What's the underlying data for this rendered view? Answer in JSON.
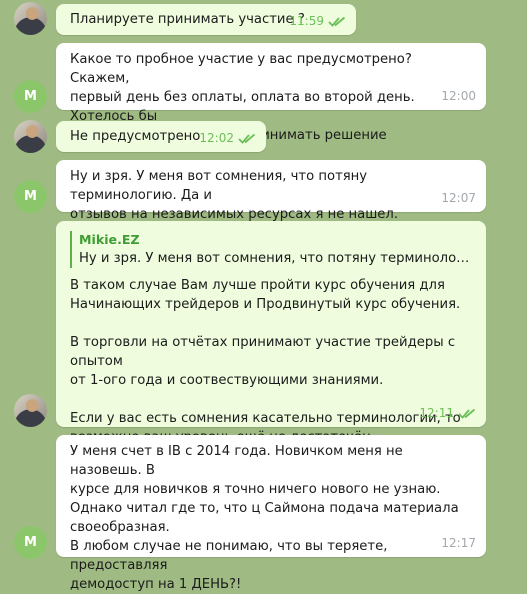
{
  "messages": [
    {
      "author": "self",
      "text": "Планируете принимать участие ?",
      "time": "11:59",
      "read": true
    },
    {
      "author": "other",
      "avatar_letter": "M",
      "text": "Какое то пробное участие у вас предусмотрено? Скажем,\nпервый день без оплаты, оплата во второй день. Хотелось бы\nпосмотреть прежде чем принимать решение",
      "time": "12:00"
    },
    {
      "author": "self",
      "text": "Не предусмотрено",
      "time": "12:02",
      "read": true
    },
    {
      "author": "other",
      "avatar_letter": "M",
      "text": "Ну и зря. У меня вот сомнения, что потяну терминологию. Да и\nотзывов на независимых ресурсах я не нашел.",
      "time": "12:07"
    },
    {
      "author": "self",
      "reply": {
        "name": "Mikie.EZ",
        "text": "Ну и зря. У меня вот сомнения, что потяну терминологию. Да и отзывов на независимых ресурсах я не нашел."
      },
      "text": "В таком случае Вам лучше пройти курс обучения для\nНачинающих трейдеров  и Продвинутый курс обучения.\n\nВ торговли на отчётах принимают участие трейдеры с опытом\nот 1-ого года и соотвествующими знаниями.\n\nЕсли у вас есть сомнения касательно терминологии,  то\nвозможно ваш уровень ещё не  достаточён",
      "time": "12:11",
      "read": true
    },
    {
      "author": "other",
      "avatar_letter": "M",
      "text": "У меня счет в IB с 2014 года. Новичком меня не назовешь. В\nкурсе для новичков я точно ничего нового не узнаю.\nОднако читал где то, что ц Саймона подача материала\nсвоеобразная.\nВ любом случае не понимаю, что вы теряете, предоставляя\nдемодоступ на 1 ДЕНЬ?!",
      "time": "12:17"
    }
  ],
  "colors": {
    "background": "#9fbb83",
    "outgoing_bubble": "#effdde",
    "incoming_bubble": "#ffffff",
    "read_check": "#6cbf58",
    "avatar_m": "#8cc66a",
    "reply_name": "#3f9d33"
  },
  "icons": {
    "read_status": "double-check-icon"
  }
}
